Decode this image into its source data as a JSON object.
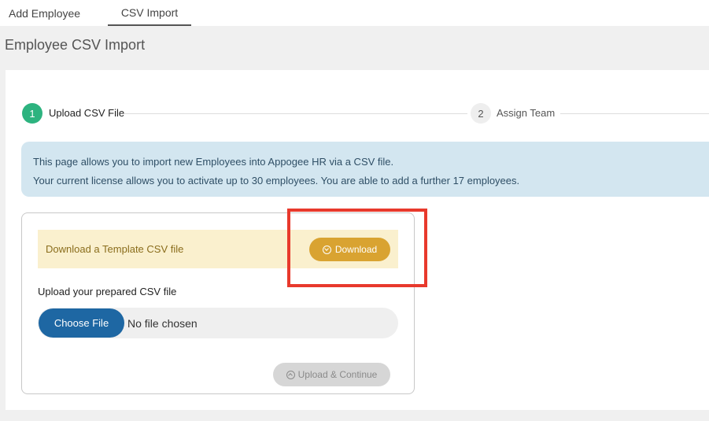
{
  "tabs": {
    "add_employee": "Add Employee",
    "csv_import": "CSV Import"
  },
  "page": {
    "title": "Employee CSV Import"
  },
  "stepper": {
    "step1": {
      "number": "1",
      "label": "Upload CSV File"
    },
    "step2": {
      "number": "2",
      "label": "Assign Team"
    }
  },
  "alert": {
    "line1": "This page allows you to import new Employees into Appogee HR via a CSV file.",
    "line2": "Your current license allows you to activate up to 30 employees. You are able to add a further 17 employees."
  },
  "template": {
    "text": "Download a Template CSV file",
    "download_label": "Download",
    "download_icon": "download-circle-icon"
  },
  "upload": {
    "label": "Upload your prepared CSV file",
    "choose_label": "Choose File",
    "no_file_text": "No file chosen",
    "continue_label": "Upload & Continue",
    "continue_icon": "upload-circle-icon"
  },
  "colors": {
    "step_active": "#2db37f",
    "alert_bg": "#d3e6f0",
    "template_bg": "#faf0ce",
    "download_btn": "#d9a331",
    "choose_btn": "#1e67a3",
    "highlight": "#e8392c"
  }
}
